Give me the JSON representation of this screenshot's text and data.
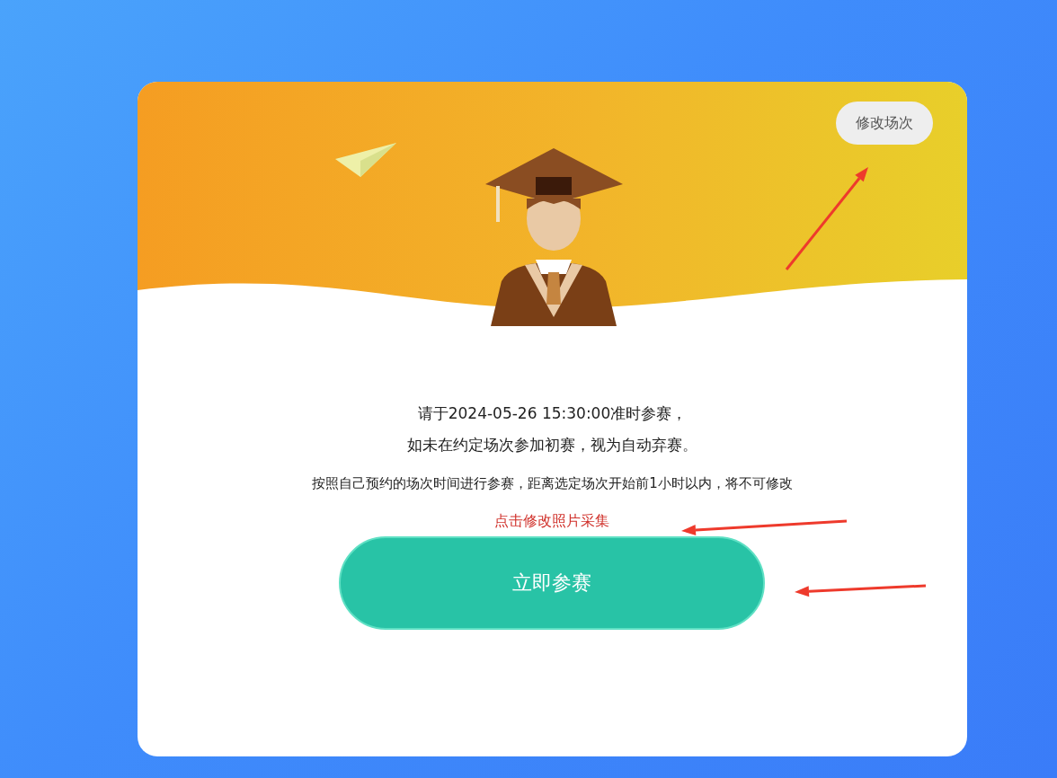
{
  "change_session_button": "修改场次",
  "notice_lines": [
    "请于2024-05-26 15:30:00准时参赛，",
    "如未在约定场次参加初赛，视为自动弃赛。"
  ],
  "rule_text": "按照自己预约的场次时间进行参赛，距离选定场次开始前1小时以内，将不可修改",
  "photo_link": "点击修改照片采集",
  "join_button": "立即参赛"
}
